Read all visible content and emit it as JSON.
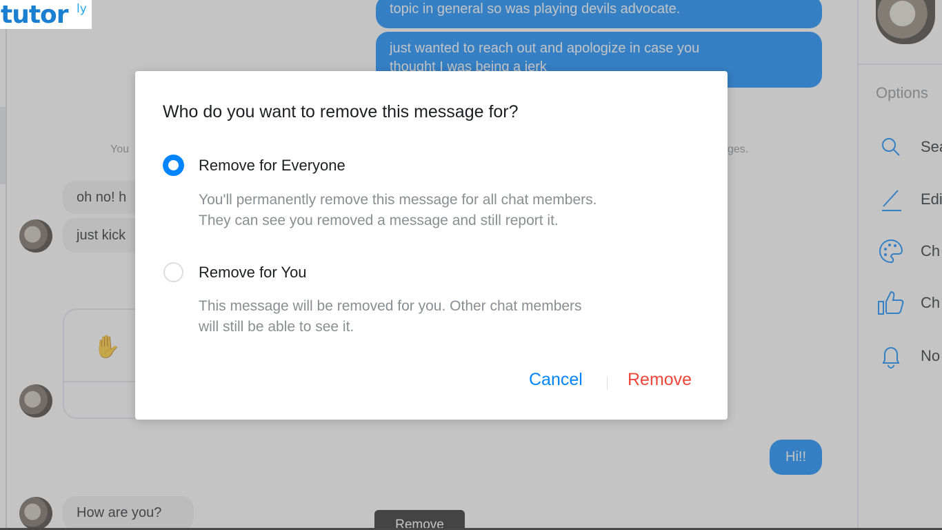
{
  "logo": {
    "word": "tutor",
    "suffix": "ly"
  },
  "chat": {
    "outgoing": [
      {
        "text": "topic in general so was playing devils advocate."
      },
      {
        "line1": "just wanted to reach out and apologize in case you",
        "line2": "thought I was being a jerk"
      },
      {
        "text": "Hi!!"
      }
    ],
    "system_left": "You",
    "system_right": "ges.",
    "incoming": [
      {
        "text": "oh no! h"
      },
      {
        "text": "just kick"
      },
      {
        "text": "How are you?"
      }
    ],
    "tooltip": "Remove",
    "accent_color": "#0084ff"
  },
  "right_panel": {
    "title": "Options",
    "items": [
      {
        "icon": "search-icon",
        "label": "Sea"
      },
      {
        "icon": "pencil-icon",
        "label": "Edi"
      },
      {
        "icon": "palette-icon",
        "label": "Ch"
      },
      {
        "icon": "thumbs-up-icon",
        "label": "Ch"
      },
      {
        "icon": "bell-icon",
        "label": "No"
      }
    ]
  },
  "modal": {
    "title": "Who do you want to remove this message for?",
    "options": [
      {
        "label": "Remove for Everyone",
        "selected": true,
        "desc_line1": "You'll permanently remove this message for all chat members.",
        "desc_line2": "They can see you removed a message and still report it."
      },
      {
        "label": "Remove for You",
        "selected": false,
        "desc_line1": "This message will be removed for you. Other chat members",
        "desc_line2": "will still be able to see it."
      }
    ],
    "cancel_label": "Cancel",
    "remove_label": "Remove",
    "cancel_color": "#0084ff",
    "remove_color": "#f0463a"
  }
}
